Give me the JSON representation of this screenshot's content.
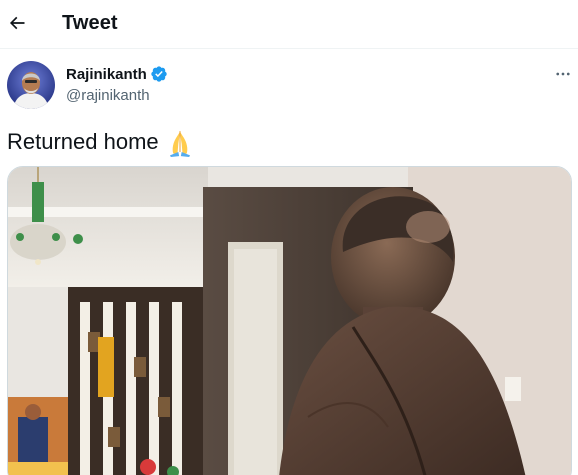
{
  "header": {
    "title": "Tweet",
    "back_icon": "arrow-left-icon"
  },
  "author": {
    "name": "Rajinikanth",
    "handle": "@rajinikanth",
    "verified": true,
    "verified_color": "#1d9bf0"
  },
  "tweet": {
    "text": "Returned home",
    "emoji": "folded-hands-emoji"
  },
  "media": {
    "alt": "Image"
  },
  "colors": {
    "text_primary": "#0f1419",
    "text_secondary": "#536471",
    "border": "#cfd9de"
  }
}
